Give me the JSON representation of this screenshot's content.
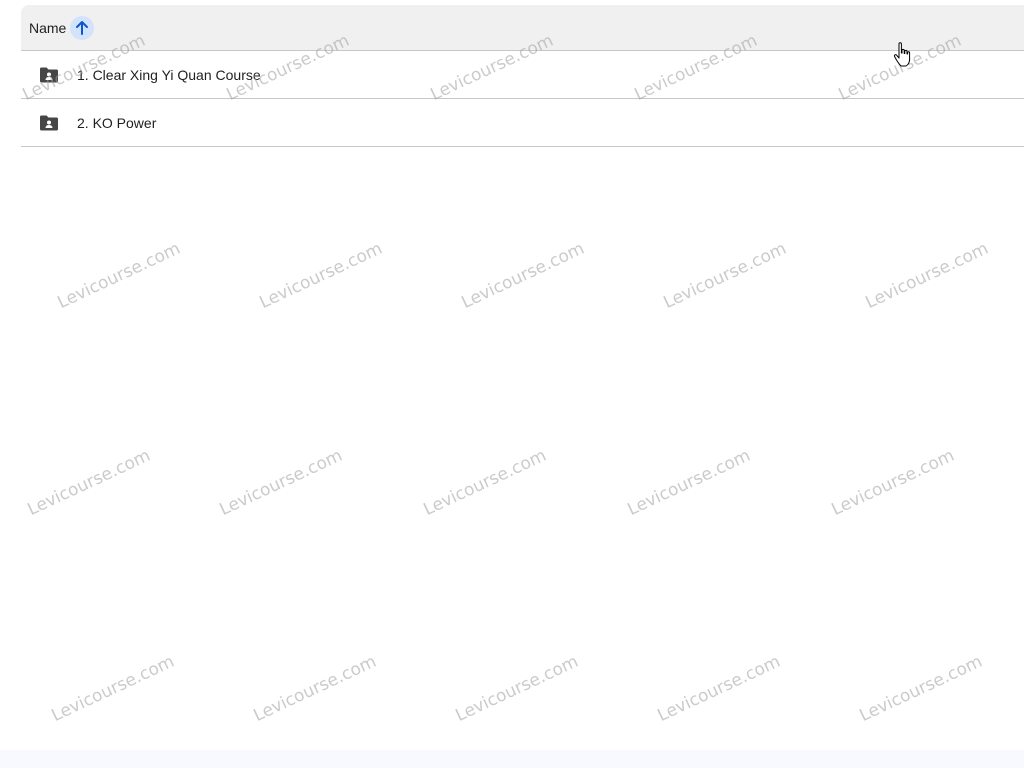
{
  "header": {
    "name_label": "Name",
    "sort_icon": "arrow-up-icon"
  },
  "files": [
    {
      "label": "1. Clear Xing Yi Quan Course",
      "icon": "shared-folder-icon"
    },
    {
      "label": "2. KO Power",
      "icon": "shared-folder-icon"
    }
  ],
  "watermark": "Levicourse.com",
  "colors": {
    "header_bg": "#f0f0f0",
    "divider": "#c7c7c7",
    "sort_highlight": "#d3e3fd",
    "sort_arrow": "#0b57d0",
    "folder_icon": "#444746"
  }
}
